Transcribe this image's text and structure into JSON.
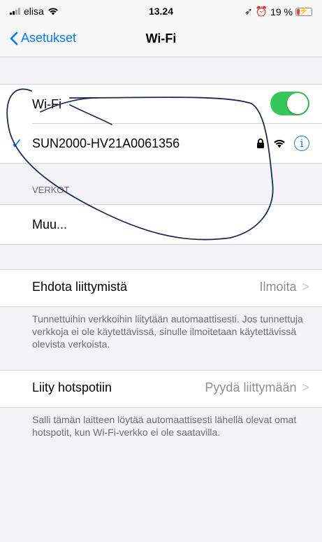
{
  "status_bar": {
    "carrier": "elisa",
    "time": "13.24",
    "battery": "19 %"
  },
  "nav": {
    "back_label": "Asetukset",
    "title": "Wi-Fi"
  },
  "wifi": {
    "toggle_label": "Wi-Fi",
    "enabled": true,
    "network_name": "SUN2000-HV21A0061356"
  },
  "networks": {
    "header": "VERKOT",
    "other_label": "Muu..."
  },
  "ask_to_join": {
    "label": "Ehdota liittymistä",
    "value": "Ilmoita",
    "description": "Tunnettuihin verkkoihin liitytään automaattisesti. Jos tunnettuja verkkoja ei ole käytettävissä, sinulle ilmoitetaan käytettävissä olevista verkoista."
  },
  "hotspot": {
    "label": "Liity hotspotiin",
    "value": "Pyydä liittymään",
    "description": "Salli tämän laitteen löytää automaattisesti lähellä olevat omat hotspotit, kun Wi-Fi-verkko ei ole saatavilla."
  },
  "colors": {
    "accent": "#007aff",
    "toggle_on": "#34c759",
    "annotation": "#1c2a5a"
  }
}
